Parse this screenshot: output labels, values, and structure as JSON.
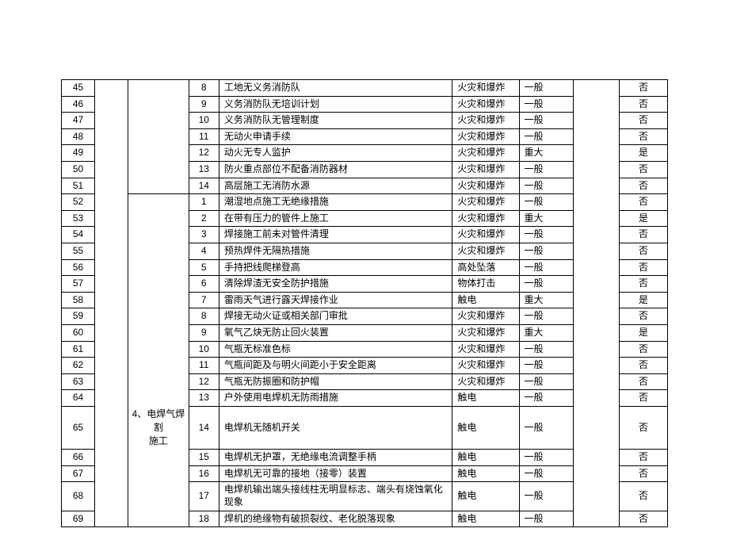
{
  "category": "4、电焊气焊割施工",
  "rows": [
    {
      "idx": "45",
      "sub": "8",
      "desc": "工地无义务消防队",
      "type": "火灾和爆炸",
      "sev": "一般",
      "yn": "否",
      "group": 0
    },
    {
      "idx": "46",
      "sub": "9",
      "desc": "义务消防队无培训计划",
      "type": "火灾和爆炸",
      "sev": "一般",
      "yn": "否",
      "group": 0
    },
    {
      "idx": "47",
      "sub": "10",
      "desc": "义务消防队无管理制度",
      "type": "火灾和爆炸",
      "sev": "一般",
      "yn": "否",
      "group": 0
    },
    {
      "idx": "48",
      "sub": "11",
      "desc": "无动火申请手续",
      "type": "火灾和爆炸",
      "sev": "一般",
      "yn": "否",
      "group": 0
    },
    {
      "idx": "49",
      "sub": "12",
      "desc": "动火无专人监护",
      "type": "火灾和爆炸",
      "sev": "重大",
      "yn": "是",
      "group": 0
    },
    {
      "idx": "50",
      "sub": "13",
      "desc": "防火重点部位不配备消防器材",
      "type": "火灾和爆炸",
      "sev": "一般",
      "yn": "否",
      "group": 0
    },
    {
      "idx": "51",
      "sub": "14",
      "desc": "高层施工无消防水源",
      "type": "火灾和爆炸",
      "sev": "一般",
      "yn": "否",
      "group": 0
    },
    {
      "idx": "52",
      "sub": "1",
      "desc": "潮湿地点施工无绝缘措施",
      "type": "火灾和爆炸",
      "sev": "一般",
      "yn": "否",
      "group": 1
    },
    {
      "idx": "53",
      "sub": "2",
      "desc": "在带有压力的管件上施工",
      "type": "火灾和爆炸",
      "sev": "重大",
      "yn": "是",
      "group": 1
    },
    {
      "idx": "54",
      "sub": "3",
      "desc": "焊接施工前未对管件清理",
      "type": "火灾和爆炸",
      "sev": "一般",
      "yn": "否",
      "group": 1
    },
    {
      "idx": "55",
      "sub": "4",
      "desc": "预热焊件无隔热措施",
      "type": "火灾和爆炸",
      "sev": "一般",
      "yn": "否",
      "group": 1
    },
    {
      "idx": "56",
      "sub": "5",
      "desc": "手持把线爬梯登高",
      "type": "高处坠落",
      "sev": "一般",
      "yn": "否",
      "group": 1
    },
    {
      "idx": "57",
      "sub": "6",
      "desc": "清除焊渣无安全防护措施",
      "type": "物体打击",
      "sev": "一般",
      "yn": "否",
      "group": 1
    },
    {
      "idx": "58",
      "sub": "7",
      "desc": "雷雨天气进行露天焊接作业",
      "type": "触电",
      "sev": "重大",
      "yn": "是",
      "group": 1
    },
    {
      "idx": "59",
      "sub": "8",
      "desc": "焊接无动火证或相关部门审批",
      "type": "火灾和爆炸",
      "sev": "一般",
      "yn": "否",
      "group": 1
    },
    {
      "idx": "60",
      "sub": "9",
      "desc": "氧气乙炔无防止回火装置",
      "type": "火灾和爆炸",
      "sev": "重大",
      "yn": "是",
      "group": 1
    },
    {
      "idx": "61",
      "sub": "10",
      "desc": "气瓶无标准色标",
      "type": "火灾和爆炸",
      "sev": "一般",
      "yn": "否",
      "group": 1
    },
    {
      "idx": "62",
      "sub": "11",
      "desc": "气瓶间距及与明火间距小于安全距离",
      "type": "火灾和爆炸",
      "sev": "一般",
      "yn": "否",
      "group": 1
    },
    {
      "idx": "63",
      "sub": "12",
      "desc": "气瓶无防振圈和防护帽",
      "type": "火灾和爆炸",
      "sev": "一般",
      "yn": "否",
      "group": 1
    },
    {
      "idx": "64",
      "sub": "13",
      "desc": "户外使用电焊机无防雨措施",
      "type": "触电",
      "sev": "一般",
      "yn": "否",
      "group": 1
    },
    {
      "idx": "65",
      "sub": "14",
      "desc": "电焊机无随机开关",
      "type": "触电",
      "sev": "一般",
      "yn": "否",
      "group": 1
    },
    {
      "idx": "66",
      "sub": "15",
      "desc": "电焊机无护罩，无绝缘电流调整手柄",
      "type": "触电",
      "sev": "一般",
      "yn": "否",
      "group": 1
    },
    {
      "idx": "67",
      "sub": "16",
      "desc": "电焊机无可靠的接地（接零）装置",
      "type": "触电",
      "sev": "一般",
      "yn": "否",
      "group": 1
    },
    {
      "idx": "68",
      "sub": "17",
      "desc": "电焊机输出端头接线柱无明显标志、端头有烧蚀氧化现象",
      "type": "触电",
      "sev": "一般",
      "yn": "否",
      "group": 1
    },
    {
      "idx": "69",
      "sub": "18",
      "desc": "焊机的绝缘物有破损裂纹、老化脱落现象",
      "type": "触电",
      "sev": "一般",
      "yn": "否",
      "group": 1
    }
  ]
}
